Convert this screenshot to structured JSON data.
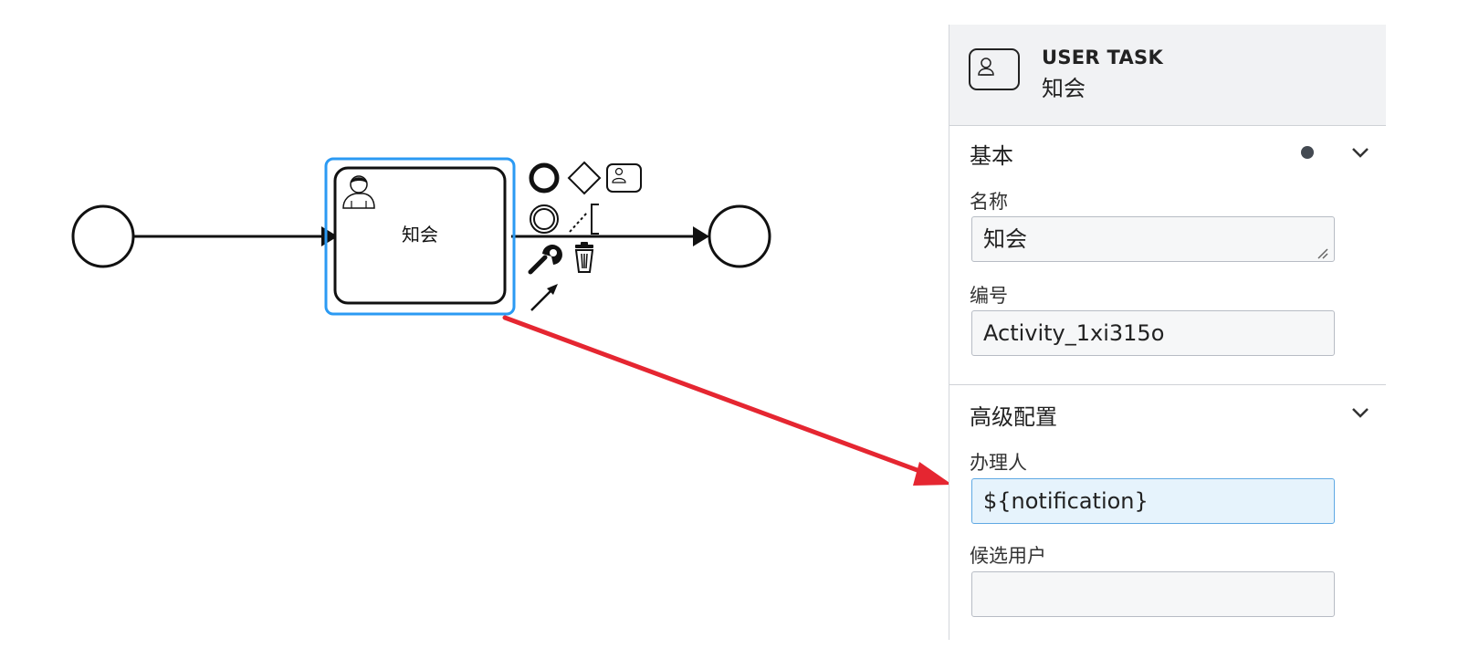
{
  "diagram": {
    "task_label": "知会"
  },
  "panel": {
    "header": {
      "type": "USER TASK",
      "name": "知会",
      "icon": "user-task-icon"
    },
    "groups": {
      "basic": {
        "title": "基本",
        "fields": {
          "name": {
            "label": "名称",
            "value": "知会"
          },
          "id": {
            "label": "编号",
            "value": "Activity_1xi315o"
          }
        }
      },
      "advanced": {
        "title": "高级配置",
        "fields": {
          "assignee": {
            "label": "办理人",
            "value": "${notification}"
          },
          "candidate_users": {
            "label": "候选用户",
            "value": ""
          }
        }
      }
    }
  },
  "colors": {
    "selection": "#2b9af3",
    "annotation": "#e52631",
    "active_field_bg": "#e6f3fc"
  }
}
